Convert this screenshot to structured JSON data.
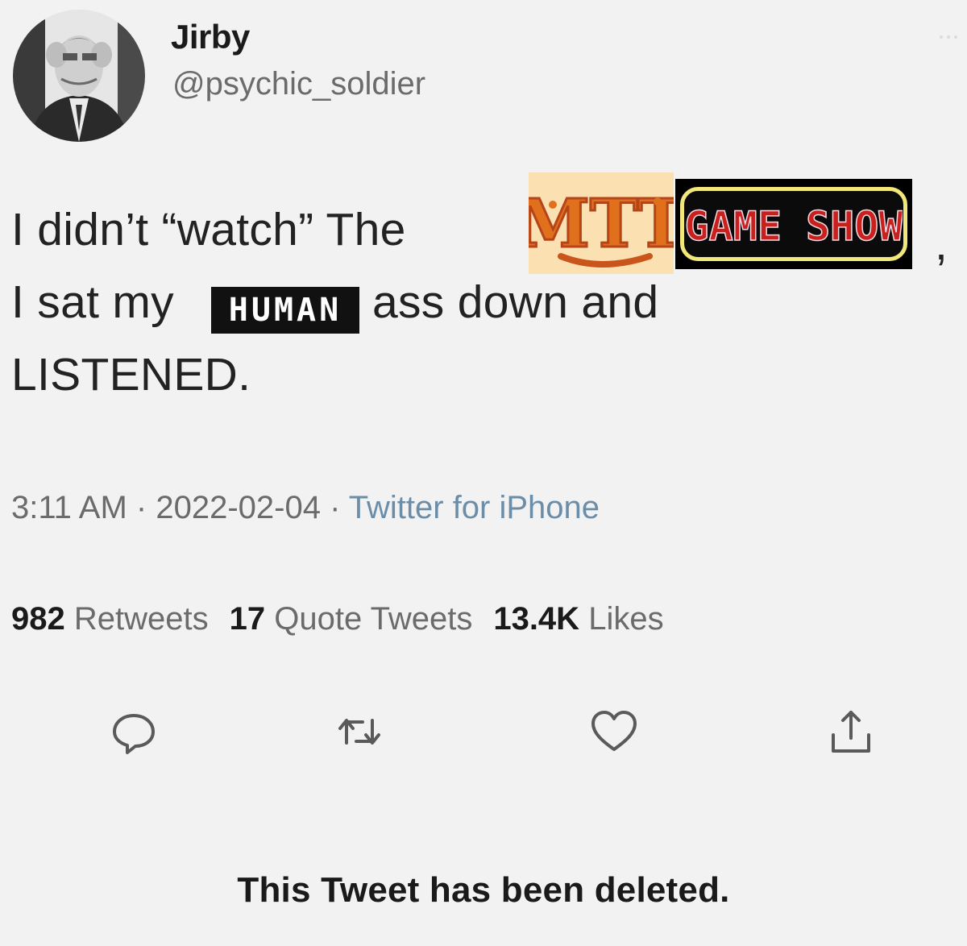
{
  "tweet": {
    "author": {
      "display_name": "Jirby",
      "handle": "@psychic_soldier"
    },
    "text": {
      "line1_prefix": "I didn’t “watch” The",
      "line1_suffix": ",",
      "line2_prefix": "I sat my",
      "line2_suffix": "ass down and",
      "line3": "LISTENED."
    },
    "inline_images": {
      "mtt_logo": "MTT",
      "gameshow_logo": "GAME SHOW",
      "human_badge": "HUMAN"
    },
    "meta": {
      "time": "3:11 AM",
      "separator": " · ",
      "date": "2022-02-04",
      "source": "Twitter for iPhone"
    },
    "stats": {
      "retweets_count": "982",
      "retweets_label": "Retweets",
      "quotes_count": "17",
      "quotes_label": "Quote Tweets",
      "likes_count": "13.4K",
      "likes_label": "Likes"
    },
    "actions": [
      "reply-icon",
      "retweet-icon",
      "like-icon",
      "share-icon"
    ],
    "status_message": "This Tweet has been deleted."
  },
  "colors": {
    "background": "#f2f2f2",
    "text": "#1e1e1e",
    "secondary_text": "#6b6b6b",
    "source_link": "#6c8da8",
    "mtt_orange": "#e0701c",
    "gameshow_red": "#c8201c",
    "gameshow_border": "#f2e77a"
  }
}
